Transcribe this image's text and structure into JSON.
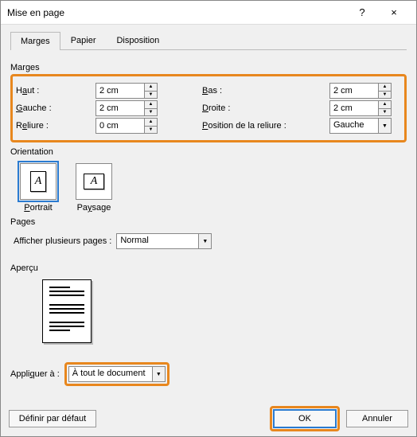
{
  "window": {
    "title": "Mise en page",
    "help": "?",
    "close": "×"
  },
  "tabs": {
    "marges": "Marges",
    "papier": "Papier",
    "disposition": "Disposition"
  },
  "groups": {
    "marges": "Marges",
    "orientation": "Orientation",
    "pages": "Pages",
    "apercu": "Aperçu"
  },
  "margins": {
    "haut_lbl_pre": "H",
    "haut_lbl_u": "a",
    "haut_lbl_post": "ut :",
    "haut_val": "2 cm",
    "bas_lbl_u": "B",
    "bas_lbl_post": "as :",
    "bas_val": "2 cm",
    "gauche_lbl_u": "G",
    "gauche_lbl_post": "auche :",
    "gauche_val": "2 cm",
    "droite_lbl_u": "D",
    "droite_lbl_post": "roite :",
    "droite_val": "2 cm",
    "reliure_lbl_pre": "R",
    "reliure_lbl_u": "e",
    "reliure_lbl_post": "liure :",
    "reliure_val": "0 cm",
    "posrel_lbl_u": "P",
    "posrel_lbl_post": "osition de la reliure :",
    "posrel_val": "Gauche"
  },
  "orientation": {
    "portrait_u": "P",
    "portrait_rest": "ortrait",
    "paysage_pre": "Pa",
    "paysage_u": "y",
    "paysage_post": "sage"
  },
  "pages": {
    "afficher_lbl": "Afficher plusieurs pages :",
    "mode": "Normal"
  },
  "apply": {
    "label_pre": "Appli",
    "label_u": "q",
    "label_post": "uer à :",
    "value": "À tout le document"
  },
  "footer": {
    "defaults": "Définir par défaut",
    "ok": "OK",
    "cancel": "Annuler"
  }
}
